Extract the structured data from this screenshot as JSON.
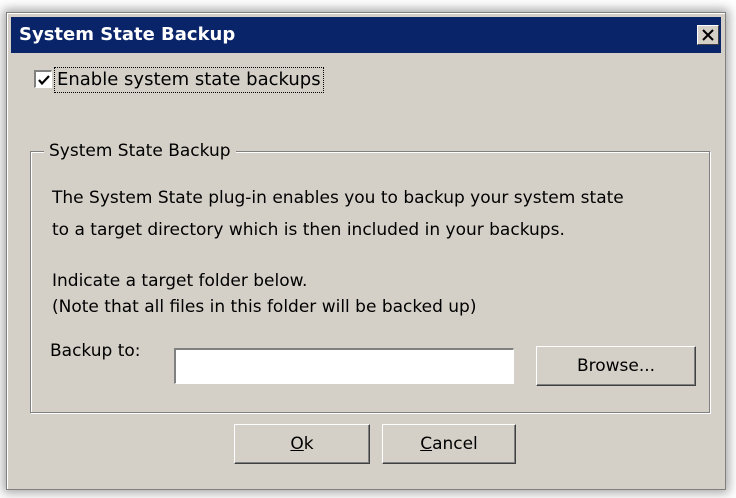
{
  "window": {
    "title": "System State Backup",
    "close_glyph": "✕"
  },
  "checkbox": {
    "label": "Enable system state backups",
    "checked": true
  },
  "group": {
    "legend": "System State Backup",
    "description_lines": [
      "The System State plug-in enables you to backup your system state",
      "to a target directory which is then included in your backups."
    ],
    "instruction_lines": [
      "Indicate a target folder below.",
      "(Note that all files in this folder will be backed up)"
    ],
    "backup_label": "Backup to:",
    "backup_value": "",
    "browse_label": "Browse..."
  },
  "buttons": {
    "ok_mnemonic": "O",
    "ok_rest": "k",
    "cancel_mnemonic": "C",
    "cancel_rest": "ancel"
  },
  "colors": {
    "titlebar": "#0a246a",
    "dialog_face": "#d4d0c8"
  }
}
